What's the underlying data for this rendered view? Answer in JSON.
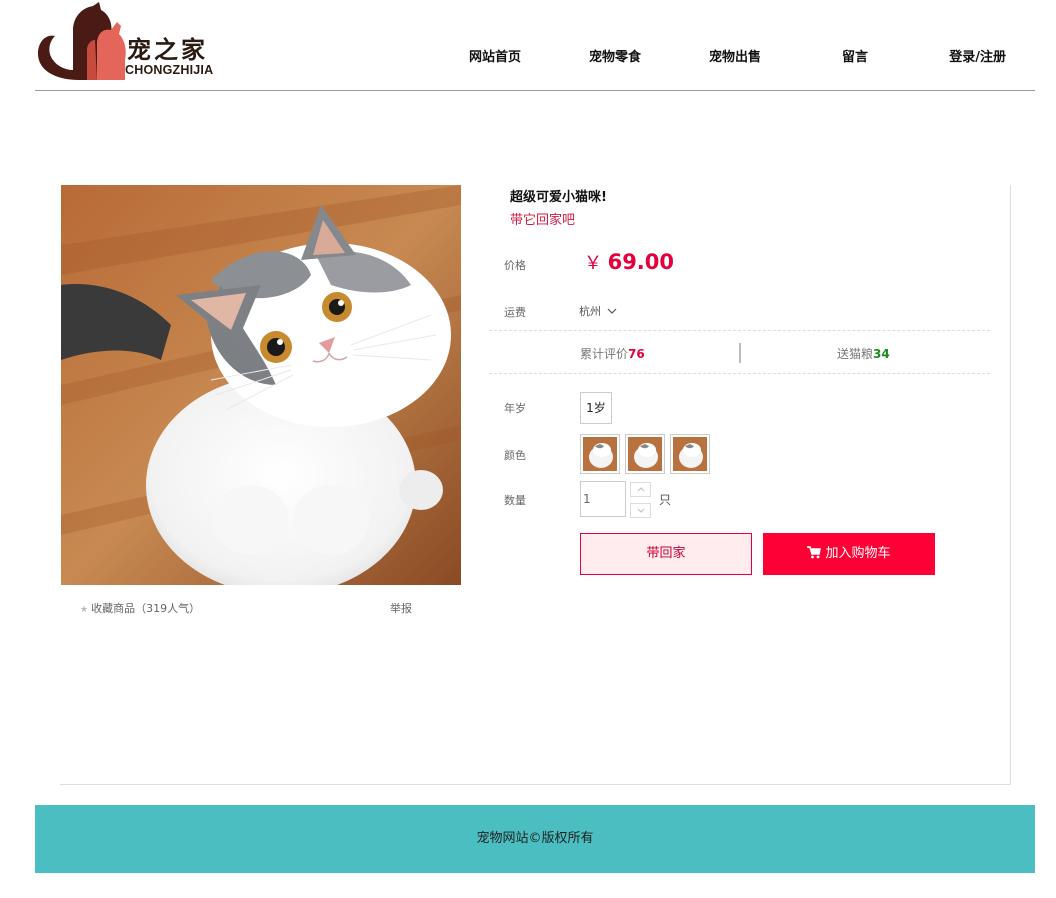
{
  "brand": {
    "name_cn": "宠之家",
    "name_en": "CHONGZHIJIA"
  },
  "nav": {
    "items": [
      {
        "label": "网站首页"
      },
      {
        "label": "宠物零食"
      },
      {
        "label": "宠物出售"
      },
      {
        "label": "留言"
      },
      {
        "label": "登录/注册"
      }
    ]
  },
  "product": {
    "title": "超级可爱小猫咪!",
    "subtitle": "带它回家吧",
    "price_label": "价格",
    "currency": "￥",
    "price": "69.00",
    "shipping_label": "运费",
    "shipping_value": "杭州",
    "review_label": "累计评价",
    "review_count": "76",
    "gift_label": "送猫粮",
    "gift_count": "34",
    "age_label": "年岁",
    "age_option": "1岁",
    "color_label": "颜色",
    "quantity_label": "数量",
    "quantity_value": "1",
    "unit": "只",
    "favorite_label": "收藏商品",
    "favorite_popularity": "（319人气）",
    "report_label": "举报",
    "buy_button": "带回家",
    "cart_button": "加入购物车"
  },
  "colors": {
    "accent": "#ff0036",
    "price": "#e4003d",
    "gift_count": "#1b8a1b",
    "footer_bg": "#4bbec1"
  },
  "icons": {
    "favorite": "star-icon",
    "shipping_dropdown": "chevron-down-icon",
    "stepper_up": "chevron-up-icon",
    "stepper_down": "chevron-down-icon",
    "cart": "cart-icon"
  },
  "footer": {
    "copyright": "宠物网站©版权所有"
  }
}
